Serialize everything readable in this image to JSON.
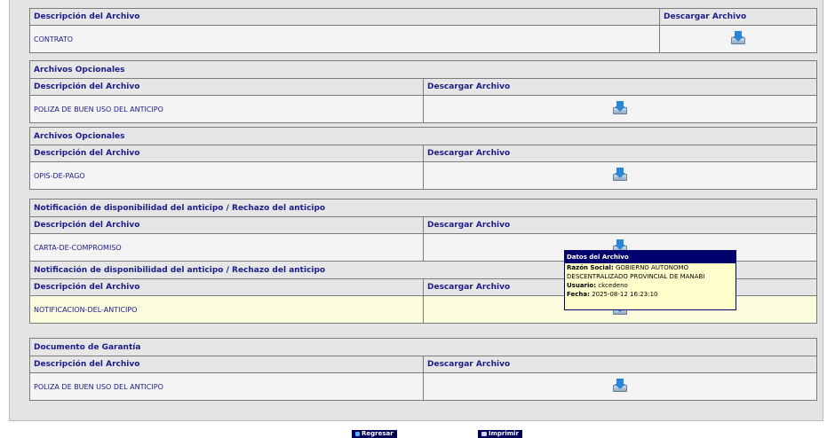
{
  "headers": {
    "description": "Descripción del Archivo",
    "download": "Descargar Archivo"
  },
  "sections": [
    {
      "title": "",
      "file": "CONTRATO"
    },
    {
      "title": "Archivos Opcionales",
      "file": "POLIZA DE BUEN USO DEL ANTICIPO"
    },
    {
      "title": "Archivos Opcionales",
      "file": "OPIS-DE-PAGO"
    },
    {
      "title": "Notificación de disponibilidad del anticipo / Rechazo del anticipo",
      "file": "CARTA-DE-COMPROMISO"
    },
    {
      "title": "Notificación de disponibilidad del anticipo / Rechazo del anticipo",
      "file": "NOTIFICACION-DEL-ANTICIPO"
    },
    {
      "title": "Documento de Garantía",
      "file": "POLIZA DE BUEN USO DEL ANTICIPO"
    }
  ],
  "tooltip": {
    "title": "Datos del Archivo",
    "razon_label": "Razón Social:",
    "razon_value": "GOBIERNO AUTONOMO",
    "razon_value2": "DESCENTRALIZADO PROVINCIAL DE MANABI",
    "usuario_label": "Usuario:",
    "usuario_value": "ckcedeno",
    "fecha_label": "Fecha:",
    "fecha_value": "2025-08-12 16:23:10"
  },
  "buttons": {
    "back": "Regresar",
    "print": "Imprimir"
  }
}
